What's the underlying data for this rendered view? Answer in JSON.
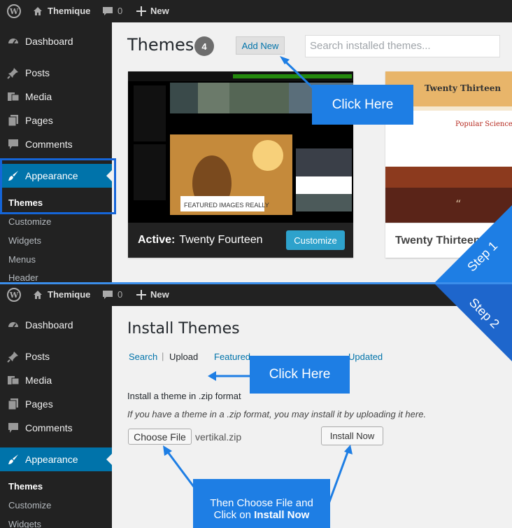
{
  "adminbar": {
    "site_name": "Themique",
    "comments_count": "0",
    "new_label": "New"
  },
  "sidebar": {
    "items": [
      {
        "label": "Dashboard",
        "icon": "dashboard-icon"
      },
      {
        "label": "Posts",
        "icon": "pin-icon"
      },
      {
        "label": "Media",
        "icon": "media-icon"
      },
      {
        "label": "Pages",
        "icon": "pages-icon"
      },
      {
        "label": "Comments",
        "icon": "comment-icon"
      },
      {
        "label": "Appearance",
        "icon": "brush-icon"
      }
    ],
    "submenu": [
      "Themes",
      "Customize",
      "Widgets",
      "Menus",
      "Header"
    ]
  },
  "step1": {
    "title": "Themes",
    "count": "4",
    "add_new_label": "Add New",
    "search_placeholder": "Search installed themes...",
    "active_theme_prefix": "Active:",
    "active_theme_name": "Twenty Fourteen",
    "customize_label": "Customize",
    "second_theme_name": "Twenty Thirteen",
    "thumb2_title": "Twenty Thirteen",
    "thumb2_post_title": "Popular Science",
    "thumb1_caption": "FEATURED IMAGES REALLY",
    "callout": "Click Here",
    "step_label": "Step 1"
  },
  "step2": {
    "title": "Install Themes",
    "tab_search": "Search",
    "tab_upload": "Upload",
    "tab_featured_partial": "Featured",
    "tab_updated_partial": "Updated",
    "section_heading": "Install a theme in .zip format",
    "description": "If you have a theme in a .zip format, you may install it by uploading it here.",
    "choose_file_label": "Choose File",
    "file_name": "vertikal.zip",
    "install_now_label": "Install Now",
    "callout": "Click Here",
    "callout2_line1": "Then Choose File and",
    "callout2_line2_prefix": "Click on",
    "callout2_line2_bold": "Install Now",
    "step_label": "Step 2"
  },
  "colors": {
    "admin_bar": "#222222",
    "accent": "#0073aa",
    "callout": "#1e7ee4",
    "highlight_border": "#1565d8"
  }
}
